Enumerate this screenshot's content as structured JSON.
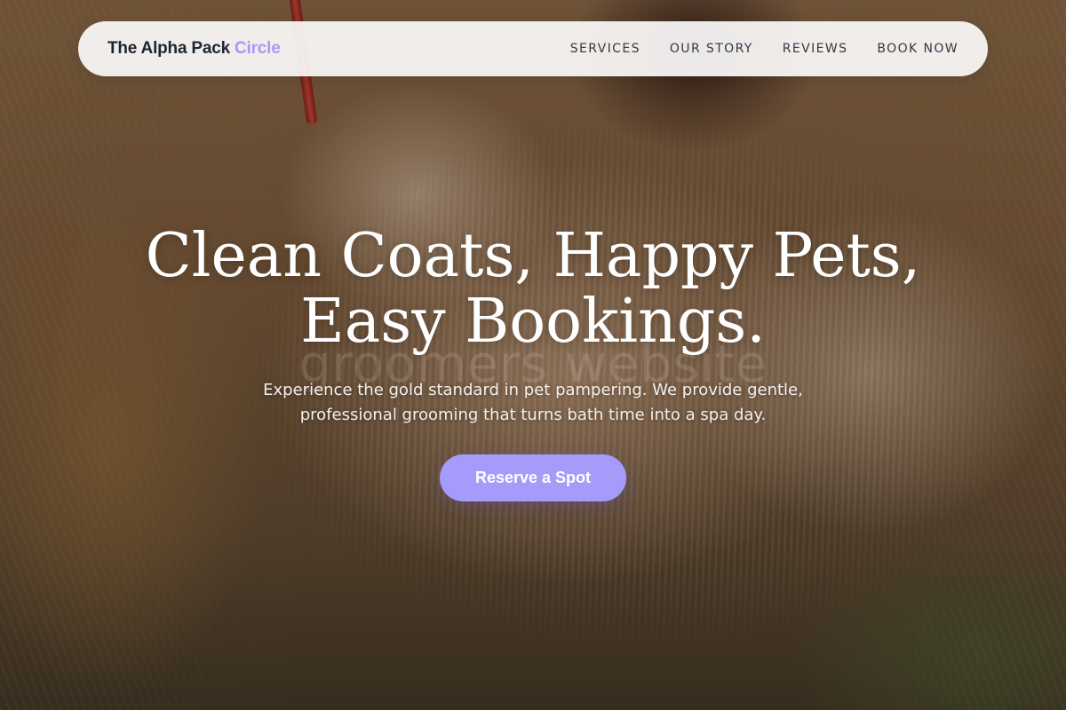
{
  "brand": {
    "name": "The Alpha Pack",
    "accent": "Circle",
    "accent_color": "#a79af5"
  },
  "nav": {
    "items": [
      {
        "label": "SERVICES"
      },
      {
        "label": "OUR STORY"
      },
      {
        "label": "REVIEWS"
      },
      {
        "label": "BOOK NOW"
      }
    ]
  },
  "hero": {
    "headline_line1": "Clean Coats, Happy Pets,",
    "headline_line2": "Easy Bookings.",
    "watermark": "groomers website",
    "subtext": "Experience the gold standard in pet pampering. We provide gentle, professional grooming that turns bath time into a spa day.",
    "cta_label": "Reserve a Spot",
    "cta_color": "#a59bfb",
    "background_image": "shaggy-corded-dog-on-grass-photo"
  }
}
